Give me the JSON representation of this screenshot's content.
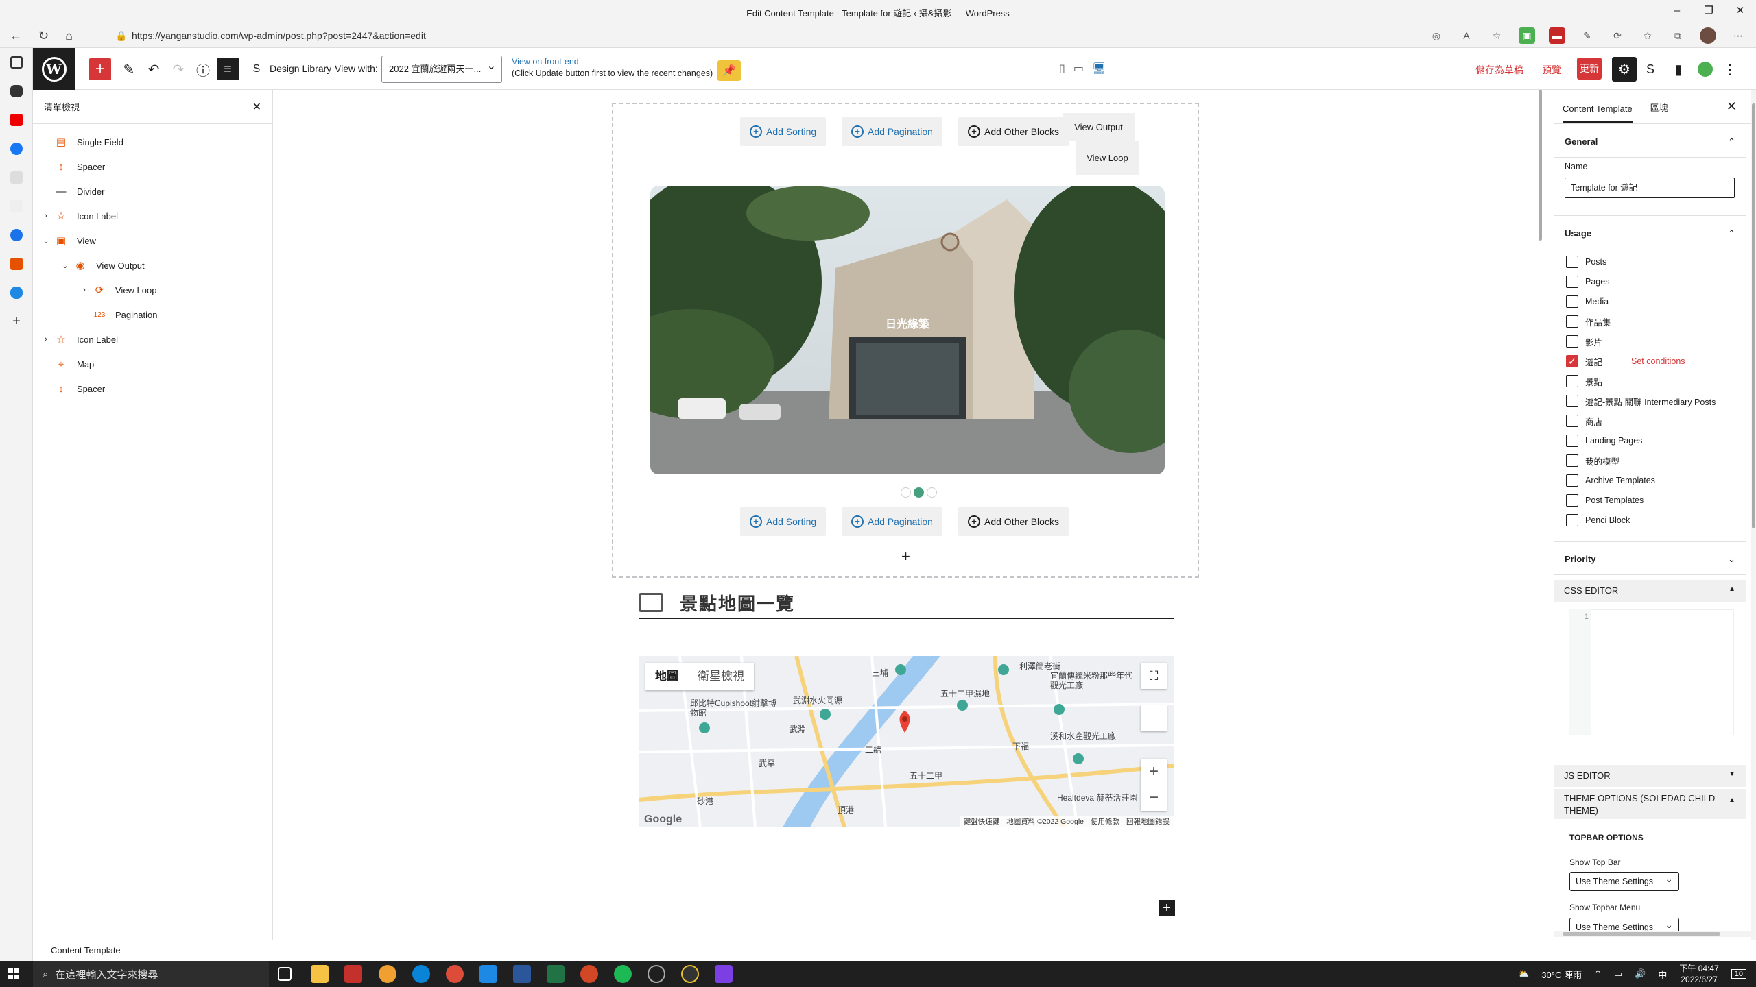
{
  "browser": {
    "window_title": "Edit Content Template - Template for 遊記 ‹ 攝&攝影 — WordPress",
    "url": "https://yanganstudio.com/wp-admin/post.php?post=2447&action=edit"
  },
  "toolbar": {
    "design_library_label": "Design Library",
    "view_with_label": "View with:",
    "view_with_value": "2022 宜蘭旅遊兩天一...",
    "view_front_end_label": "View on front-end",
    "view_front_end_note": "(Click Update button first to view the recent changes)",
    "save_draft_label": "儲存為草稿",
    "preview_label": "預覽",
    "update_label": "更新"
  },
  "list_view": {
    "title": "清單檢視",
    "items": [
      {
        "label": "Single Field",
        "indent": 0,
        "expandable": false,
        "icon": "single-field-icon"
      },
      {
        "label": "Spacer",
        "indent": 0,
        "expandable": false,
        "icon": "spacer-icon"
      },
      {
        "label": "Divider",
        "indent": 0,
        "expandable": false,
        "icon": "divider-icon"
      },
      {
        "label": "Icon Label",
        "indent": 0,
        "expandable": true,
        "icon": "icon-label-icon"
      },
      {
        "label": "View",
        "indent": 0,
        "expandable": true,
        "expanded": true,
        "icon": "view-icon"
      },
      {
        "label": "View Output",
        "indent": 1,
        "expandable": true,
        "expanded": true,
        "icon": "view-output-icon"
      },
      {
        "label": "View Loop",
        "indent": 2,
        "expandable": true,
        "icon": "view-loop-icon"
      },
      {
        "label": "Pagination",
        "indent": 2,
        "expandable": false,
        "icon": "pagination-icon"
      },
      {
        "label": "Icon Label",
        "indent": 0,
        "expandable": true,
        "icon": "icon-label-icon"
      },
      {
        "label": "Map",
        "indent": 0,
        "expandable": false,
        "icon": "map-icon"
      },
      {
        "label": "Spacer",
        "indent": 0,
        "expandable": false,
        "icon": "spacer-icon"
      }
    ]
  },
  "canvas": {
    "add_sorting": "Add Sorting",
    "add_pagination": "Add Pagination",
    "add_other_blocks": "Add Other Blocks",
    "view_output_tag": "View Output",
    "view_loop_tag": "View Loop",
    "photo_caption": "日光綠築",
    "slider_dots": 3,
    "slider_active": 1,
    "map_section_title": "景點地圖一覽",
    "map": {
      "tab_map": "地圖",
      "tab_satellite": "衛星檢視",
      "labels": [
        "三埔",
        "五十二甲濕地",
        "利澤簡老街",
        "宜蘭傳統米粉那些年代觀光工廠",
        "邱比特Cupishoot射擊博物館",
        "武淵水火同源",
        "武淵",
        "二結",
        "五十二甲",
        "下福",
        "溪和水產觀光工廠",
        "Healtdeva 赫蒂活莊園",
        "武罕",
        "砂港",
        "頂港"
      ],
      "footer": [
        "鍵盤快速鍵",
        "地圖資料 ©2022 Google",
        "使用條款",
        "回報地圖錯誤"
      ],
      "logo": "Google"
    }
  },
  "settings_panel": {
    "tabs": [
      "Content Template",
      "區塊"
    ],
    "general_title": "General",
    "name_label": "Name",
    "name_value": "Template for 遊記",
    "usage_title": "Usage",
    "usage_items": [
      {
        "label": "Posts",
        "checked": false
      },
      {
        "label": "Pages",
        "checked": false
      },
      {
        "label": "Media",
        "checked": false
      },
      {
        "label": "作品集",
        "checked": false
      },
      {
        "label": "影片",
        "checked": false
      },
      {
        "label": "遊記",
        "checked": true,
        "link": "Set conditions"
      },
      {
        "label": "景點",
        "checked": false
      },
      {
        "label": "遊記-景點 關聯 Intermediary Posts",
        "checked": false
      },
      {
        "label": "商店",
        "checked": false
      },
      {
        "label": "Landing Pages",
        "checked": false
      },
      {
        "label": "我的模型",
        "checked": false
      },
      {
        "label": "Archive Templates",
        "checked": false
      },
      {
        "label": "Post Templates",
        "checked": false
      },
      {
        "label": "Penci Block",
        "checked": false
      }
    ],
    "priority_title": "Priority",
    "css_editor_title": "CSS EDITOR",
    "css_line_number": "1",
    "js_editor_title": "JS EDITOR",
    "theme_options_title": "THEME OPTIONS (SOLEDAD CHILD THEME)",
    "topbar_options_title": "TOPBAR OPTIONS",
    "show_top_bar_label": "Show Top Bar",
    "show_top_bar_value": "Use Theme Settings",
    "show_topbar_menu_label": "Show Topbar Menu",
    "show_topbar_menu_value": "Use Theme Settings"
  },
  "status_bar": {
    "breadcrumb": "Content Template"
  },
  "taskbar": {
    "search_placeholder": "在這裡輸入文字來搜尋",
    "weather": "30°C 陣雨",
    "time": "下午 04:47",
    "date": "2022/6/27",
    "notifications": "10"
  },
  "colors": {
    "wp_accent": "#d63638",
    "link_blue": "#2271b1",
    "dark": "#1e1e1e"
  }
}
